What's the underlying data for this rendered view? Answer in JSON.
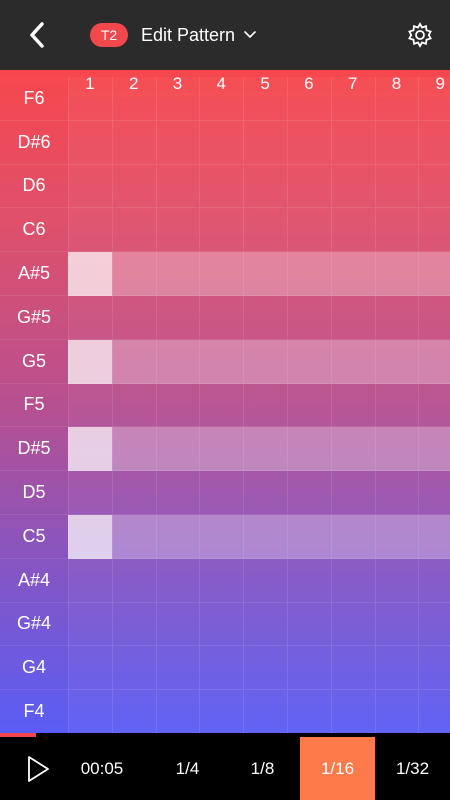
{
  "header": {
    "track_badge": "T2",
    "title": "Edit Pattern",
    "icons": {
      "back": "back-chevron-icon",
      "dropdown": "chevron-down-icon",
      "settings": "gear-icon"
    }
  },
  "grid": {
    "steps": [
      "1",
      "2",
      "3",
      "4",
      "5",
      "6",
      "7",
      "8",
      "9"
    ],
    "notes": [
      "F6",
      "D#6",
      "D6",
      "C6",
      "A#5",
      "G#5",
      "G5",
      "F5",
      "D#5",
      "D5",
      "C5",
      "A#4",
      "G#4",
      "G4",
      "F4"
    ],
    "active_notes": [
      {
        "note": "A#5",
        "start_step": 1,
        "length_steps": 9
      },
      {
        "note": "G5",
        "start_step": 1,
        "length_steps": 9
      },
      {
        "note": "D#5",
        "start_step": 1,
        "length_steps": 9
      },
      {
        "note": "C5",
        "start_step": 1,
        "length_steps": 9
      }
    ]
  },
  "transport": {
    "play_icon": "play-icon",
    "time": "00:05",
    "playback_progress": 0.08,
    "divisions": [
      "1/4",
      "1/8",
      "1/16",
      "1/32"
    ],
    "selected_division": "1/16"
  },
  "colors": {
    "accent": "#f2484c",
    "selected": "#ff7a4a",
    "header_bg": "#2b2b2b"
  }
}
